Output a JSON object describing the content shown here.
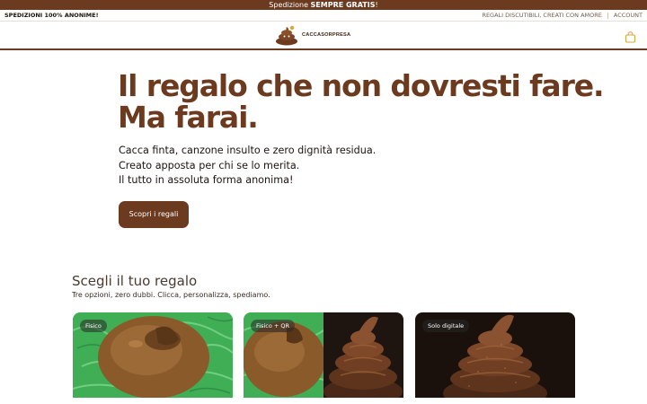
{
  "announcement": {
    "prefix": "Spedizione",
    "bold": "SEMPRE GRATIS",
    "suffix": "!"
  },
  "utility": {
    "left": "SPEDIZIONI 100% ANONIME!",
    "tagline": "REGALI DISCUTIBILI, CREATI CON AMORE",
    "account": "ACCOUNT"
  },
  "header": {
    "brand": "CACCASORPRESA",
    "cart_icon": "shopping-bag-icon"
  },
  "hero": {
    "title_line1": "Il regalo che non dovresti fare.",
    "title_line2": "Ma farai.",
    "sub_line1": "Cacca finta, canzone insulto e zero dignità residua.",
    "sub_line2": "Creato apposta per chi se lo merita.",
    "sub_line3": "Il tutto in assoluta forma anonima!",
    "cta": "Scopri i regali"
  },
  "products_section": {
    "title": "Scegli il tuo regalo",
    "subtitle": "Tre opzioni, zero dubbi. Clicca, personalizza, spediamo.",
    "cards": [
      {
        "badge": "Fisico"
      },
      {
        "badge": "Fisico + QR"
      },
      {
        "badge": "Solo digitale"
      }
    ]
  },
  "colors": {
    "brand_brown": "#6b3a1f",
    "gold": "#d9a63a",
    "grass_green": "#3fae55"
  }
}
